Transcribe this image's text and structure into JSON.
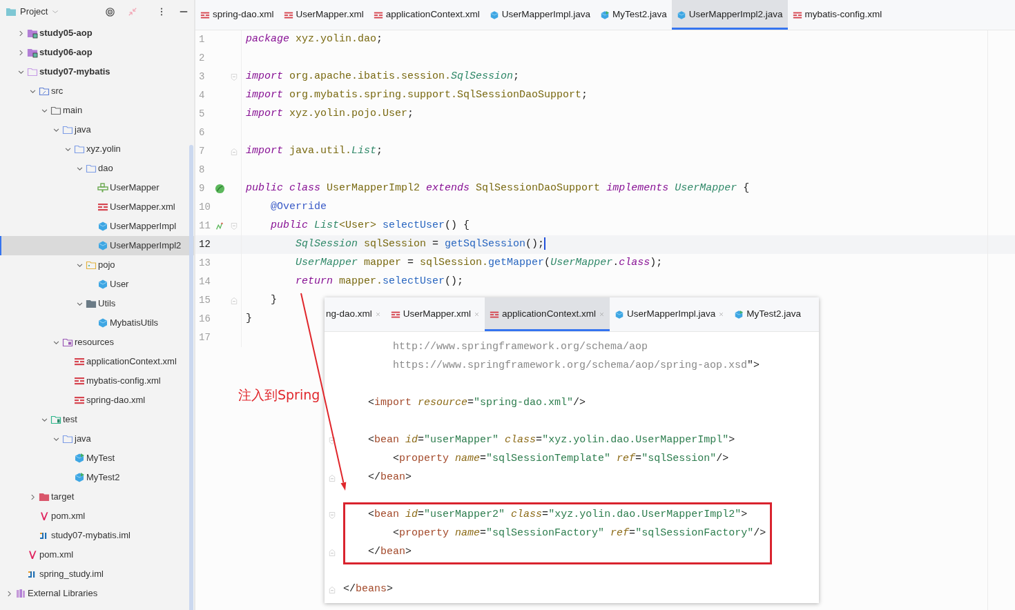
{
  "project_panel": {
    "title": "Project"
  },
  "tree": [
    {
      "children": [
        {
          "label": "study05-aop",
          "kind": "module",
          "expanded": false,
          "selected": false
        },
        {
          "label": "study06-aop",
          "kind": "module",
          "expanded": false,
          "selected": false
        },
        {
          "label": "study07-mybatis",
          "kind": "module-open",
          "expanded": true,
          "selected": false,
          "children": [
            {
              "label": "src",
              "kind": "src-folder",
              "expanded": true,
              "selected": false,
              "children": [
                {
                  "label": "main",
                  "kind": "folder",
                  "expanded": true,
                  "selected": false,
                  "children": [
                    {
                      "label": "java",
                      "kind": "source-folder",
                      "expanded": true,
                      "selected": false,
                      "children": [
                        {
                          "label": "xyz.yolin",
                          "kind": "package",
                          "expanded": true,
                          "selected": false,
                          "children": [
                            {
                              "label": "dao",
                              "kind": "package",
                              "expanded": true,
                              "selected": false,
                              "children": [
                                {
                                  "label": "UserMapper",
                                  "kind": "interface",
                                  "selected": false
                                },
                                {
                                  "label": "UserMapper.xml",
                                  "kind": "xml",
                                  "selected": false
                                },
                                {
                                  "label": "UserMapperImpl",
                                  "kind": "class",
                                  "selected": false
                                },
                                {
                                  "label": "UserMapperImpl2",
                                  "kind": "class",
                                  "selected": true
                                }
                              ]
                            },
                            {
                              "label": "pojo",
                              "kind": "pojo-folder",
                              "expanded": true,
                              "selected": false,
                              "children": [
                                {
                                  "label": "User",
                                  "kind": "class",
                                  "selected": false
                                }
                              ]
                            },
                            {
                              "label": "Utils",
                              "kind": "utils-folder",
                              "expanded": true,
                              "selected": false,
                              "children": [
                                {
                                  "label": "MybatisUtils",
                                  "kind": "class",
                                  "selected": false
                                }
                              ]
                            }
                          ]
                        }
                      ]
                    },
                    {
                      "label": "resources",
                      "kind": "resources-folder",
                      "expanded": true,
                      "selected": false,
                      "children": [
                        {
                          "label": "applicationContext.xml",
                          "kind": "xml",
                          "selected": false
                        },
                        {
                          "label": "mybatis-config.xml",
                          "kind": "xml",
                          "selected": false
                        },
                        {
                          "label": "spring-dao.xml",
                          "kind": "xml",
                          "selected": false
                        }
                      ]
                    }
                  ]
                },
                {
                  "label": "test",
                  "kind": "test-folder",
                  "expanded": true,
                  "selected": false,
                  "children": [
                    {
                      "label": "java",
                      "kind": "source-folder",
                      "expanded": true,
                      "selected": false,
                      "children": [
                        {
                          "label": "MyTest",
                          "kind": "test-class",
                          "selected": false
                        },
                        {
                          "label": "MyTest2",
                          "kind": "test-class",
                          "selected": false
                        }
                      ]
                    }
                  ]
                }
              ]
            },
            {
              "label": "target",
              "kind": "target-folder",
              "expanded": false,
              "selected": false
            },
            {
              "label": "pom.xml",
              "kind": "maven",
              "selected": false
            },
            {
              "label": "study07-mybatis.iml",
              "kind": "iml",
              "selected": false
            }
          ]
        },
        {
          "label": "pom.xml",
          "kind": "maven",
          "selected": false
        },
        {
          "label": "spring_study.iml",
          "kind": "iml",
          "selected": false
        }
      ]
    },
    {
      "label": "External Libraries",
      "kind": "libraries",
      "expanded": false,
      "selected": false
    }
  ],
  "tabs": [
    {
      "label": "spring-dao.xml",
      "kind": "xml",
      "selected": false
    },
    {
      "label": "UserMapper.xml",
      "kind": "xml",
      "selected": false
    },
    {
      "label": "applicationContext.xml",
      "kind": "xml",
      "selected": false
    },
    {
      "label": "UserMapperImpl.java",
      "kind": "class",
      "selected": false
    },
    {
      "label": "MyTest2.java",
      "kind": "test-class",
      "selected": false
    },
    {
      "label": "UserMapperImpl2.java",
      "kind": "class",
      "selected": true
    },
    {
      "label": "mybatis-config.xml",
      "kind": "xml",
      "selected": false
    }
  ],
  "code_lines": [
    {
      "number": "1",
      "current": false,
      "tokens": [
        {
          "text": "package",
          "kind": "keyword"
        },
        {
          "text": " xyz.yolin.dao",
          "kind": "name"
        },
        {
          "text": ";",
          "kind": "plain"
        }
      ]
    },
    {
      "number": "2",
      "current": false
    },
    {
      "number": "3",
      "current": false,
      "gutter": [
        {
          "kind": "fold-start"
        }
      ],
      "tokens": [
        {
          "text": "import",
          "kind": "keyword"
        },
        {
          "text": " org.apache.ibatis.session.",
          "kind": "name"
        },
        {
          "text": "SqlSession",
          "kind": "type"
        },
        {
          "text": ";",
          "kind": "plain"
        }
      ]
    },
    {
      "number": "4",
      "current": false,
      "tokens": [
        {
          "text": "import",
          "kind": "keyword"
        },
        {
          "text": " org.mybatis.spring.support.SqlSessionDaoSupport",
          "kind": "name"
        },
        {
          "text": ";",
          "kind": "plain"
        }
      ]
    },
    {
      "number": "5",
      "current": false,
      "tokens": [
        {
          "text": "import",
          "kind": "keyword"
        },
        {
          "text": " xyz.yolin.pojo.User",
          "kind": "name"
        },
        {
          "text": ";",
          "kind": "plain"
        }
      ]
    },
    {
      "number": "6",
      "current": false
    },
    {
      "number": "7",
      "current": false,
      "gutter": [
        {
          "kind": "fold-end"
        }
      ],
      "tokens": [
        {
          "text": "import",
          "kind": "keyword"
        },
        {
          "text": " java.util.",
          "kind": "name"
        },
        {
          "text": "List",
          "kind": "type"
        },
        {
          "text": ";",
          "kind": "plain"
        }
      ]
    },
    {
      "number": "8",
      "current": false
    },
    {
      "number": "9",
      "current": false,
      "gutter": [
        {
          "kind": "bean"
        }
      ],
      "tokens": [
        {
          "text": "public class",
          "kind": "keyword"
        },
        {
          "text": " UserMapperImpl2 ",
          "kind": "name"
        },
        {
          "text": "extends",
          "kind": "keyword"
        },
        {
          "text": " SqlSessionDaoSupport ",
          "kind": "name"
        },
        {
          "text": "implements ",
          "kind": "keyword"
        },
        {
          "text": "UserMapper",
          "kind": "type"
        },
        {
          "text": " {",
          "kind": "plain"
        }
      ]
    },
    {
      "number": "10",
      "current": false,
      "tokens": [
        {
          "text": "    @Override",
          "kind": "annotation"
        }
      ]
    },
    {
      "number": "11",
      "current": false,
      "gutter": [
        {
          "kind": "override"
        },
        {
          "kind": "fold-start"
        }
      ],
      "tokens": [
        {
          "text": "    public ",
          "kind": "keyword"
        },
        {
          "text": "List",
          "kind": "type"
        },
        {
          "text": "<User> ",
          "kind": "name"
        },
        {
          "text": "selectUser",
          "kind": "method"
        },
        {
          "text": "() {",
          "kind": "plain"
        }
      ]
    },
    {
      "number": "12",
      "current": true,
      "tokens": [
        {
          "text": "        SqlSession",
          "kind": "type"
        },
        {
          "text": " sqlSession ",
          "kind": "name"
        },
        {
          "text": "= ",
          "kind": "plain"
        },
        {
          "text": "getSqlSession",
          "kind": "method"
        },
        {
          "text": "();",
          "kind": "plain"
        }
      ]
    },
    {
      "number": "13",
      "current": false,
      "tokens": [
        {
          "text": "        UserMapper",
          "kind": "type"
        },
        {
          "text": " mapper ",
          "kind": "name"
        },
        {
          "text": "=",
          "kind": "plain"
        },
        {
          "text": " sqlSession.",
          "kind": "name"
        },
        {
          "text": "getMapper",
          "kind": "method"
        },
        {
          "text": "(",
          "kind": "plain"
        },
        {
          "text": "UserMapper",
          "kind": "type"
        },
        {
          "text": ".",
          "kind": "plain"
        },
        {
          "text": "class",
          "kind": "keyword"
        },
        {
          "text": ");",
          "kind": "plain"
        }
      ]
    },
    {
      "number": "14",
      "current": false,
      "tokens": [
        {
          "text": "        return",
          "kind": "keyword"
        },
        {
          "text": " mapper.",
          "kind": "name"
        },
        {
          "text": "selectUser",
          "kind": "method"
        },
        {
          "text": "();",
          "kind": "plain"
        }
      ]
    },
    {
      "number": "15",
      "current": false,
      "gutter": [
        {
          "kind": "fold-end"
        }
      ],
      "tokens": [
        {
          "text": "    }",
          "kind": "plain"
        }
      ]
    },
    {
      "number": "16",
      "current": false,
      "tokens": [
        {
          "text": "}",
          "kind": "plain"
        }
      ]
    },
    {
      "number": "17",
      "current": false
    }
  ],
  "overlay": {
    "tabs": [
      {
        "label": "ng-dao.xml",
        "selected": false,
        "close": true
      },
      {
        "label": "UserMapper.xml",
        "kind": "xml",
        "selected": false,
        "close": true
      },
      {
        "label": "applicationContext.xml",
        "kind": "xml",
        "selected": true,
        "close": true
      },
      {
        "label": "UserMapperImpl.java",
        "kind": "class",
        "selected": false,
        "close": true
      },
      {
        "label": "MyTest2.java",
        "kind": "test-class",
        "selected": false,
        "close": false
      }
    ],
    "lines": [
      {
        "boxed": false,
        "tokens": [
          {
            "text": "        http://www.springframework.org/schema/aop",
            "kind": "url"
          }
        ]
      },
      {
        "boxed": false,
        "tokens": [
          {
            "text": "        https://www.springframework.org/schema/aop/spring-aop.xsd",
            "kind": "url"
          },
          {
            "text": "\">",
            "kind": "plain"
          }
        ]
      },
      {
        "boxed": false
      },
      {
        "boxed": false,
        "tokens": [
          {
            "text": "    <",
            "kind": "plain"
          },
          {
            "text": "import",
            "kind": "tag"
          },
          {
            "text": " resource",
            "kind": "attr"
          },
          {
            "text": "=",
            "kind": "plain"
          },
          {
            "text": "\"spring-dao.xml\"",
            "kind": "value"
          },
          {
            "text": "/>",
            "kind": "plain"
          }
        ]
      },
      {
        "boxed": false
      },
      {
        "boxed": false,
        "gutter": [
          {
            "kind": "fold-start"
          }
        ],
        "tokens": [
          {
            "text": "    <",
            "kind": "plain"
          },
          {
            "text": "bean",
            "kind": "tag"
          },
          {
            "text": " id",
            "kind": "attr"
          },
          {
            "text": "=",
            "kind": "plain"
          },
          {
            "text": "\"userMapper\"",
            "kind": "value"
          },
          {
            "text": " class",
            "kind": "attr"
          },
          {
            "text": "=",
            "kind": "plain"
          },
          {
            "text": "\"xyz.yolin.dao.UserMapperImpl\"",
            "kind": "value"
          },
          {
            "text": ">",
            "kind": "plain"
          }
        ]
      },
      {
        "boxed": false,
        "tokens": [
          {
            "text": "        <",
            "kind": "plain"
          },
          {
            "text": "property",
            "kind": "tag"
          },
          {
            "text": " name",
            "kind": "attr"
          },
          {
            "text": "=",
            "kind": "plain"
          },
          {
            "text": "\"sqlSessionTemplate\"",
            "kind": "value"
          },
          {
            "text": " ref",
            "kind": "attr"
          },
          {
            "text": "=",
            "kind": "plain"
          },
          {
            "text": "\"sqlSession\"",
            "kind": "value"
          },
          {
            "text": "/>",
            "kind": "plain"
          }
        ]
      },
      {
        "boxed": false,
        "gutter": [
          {
            "kind": "fold-end"
          }
        ],
        "tokens": [
          {
            "text": "    </",
            "kind": "plain"
          },
          {
            "text": "bean",
            "kind": "tag"
          },
          {
            "text": ">",
            "kind": "plain"
          }
        ]
      },
      {
        "boxed": false
      },
      {
        "boxed": true,
        "gutter": [
          {
            "kind": "fold-start"
          }
        ],
        "tokens": [
          {
            "text": "    <",
            "kind": "plain"
          },
          {
            "text": "bean",
            "kind": "tag"
          },
          {
            "text": " id",
            "kind": "attr"
          },
          {
            "text": "=",
            "kind": "plain"
          },
          {
            "text": "\"userMapper2\"",
            "kind": "value"
          },
          {
            "text": " class",
            "kind": "attr"
          },
          {
            "text": "=",
            "kind": "plain"
          },
          {
            "text": "\"xyz.yolin.dao.UserMapperImpl2\"",
            "kind": "value"
          },
          {
            "text": ">",
            "kind": "plain"
          }
        ]
      },
      {
        "boxed": true,
        "tokens": [
          {
            "text": "        <",
            "kind": "plain"
          },
          {
            "text": "property",
            "kind": "tag"
          },
          {
            "text": " name",
            "kind": "attr"
          },
          {
            "text": "=",
            "kind": "plain"
          },
          {
            "text": "\"sqlSessionFactory\"",
            "kind": "value"
          },
          {
            "text": " ref",
            "kind": "attr"
          },
          {
            "text": "=",
            "kind": "plain"
          },
          {
            "text": "\"sqlSessionFactory\"",
            "kind": "value"
          },
          {
            "text": "/>",
            "kind": "plain"
          }
        ]
      },
      {
        "boxed": true,
        "gutter": [
          {
            "kind": "fold-end"
          }
        ],
        "tokens": [
          {
            "text": "    </",
            "kind": "plain"
          },
          {
            "text": "bean",
            "kind": "tag"
          },
          {
            "text": ">",
            "kind": "plain"
          }
        ]
      },
      {
        "boxed": false
      },
      {
        "boxed": false,
        "gutter": [
          {
            "kind": "fold-end"
          }
        ],
        "tokens": [
          {
            "text": "</",
            "kind": "plain"
          },
          {
            "text": "beans",
            "kind": "tag"
          },
          {
            "text": ">",
            "kind": "plain"
          }
        ]
      }
    ]
  },
  "annotation": {
    "text": "注入到Spring"
  }
}
